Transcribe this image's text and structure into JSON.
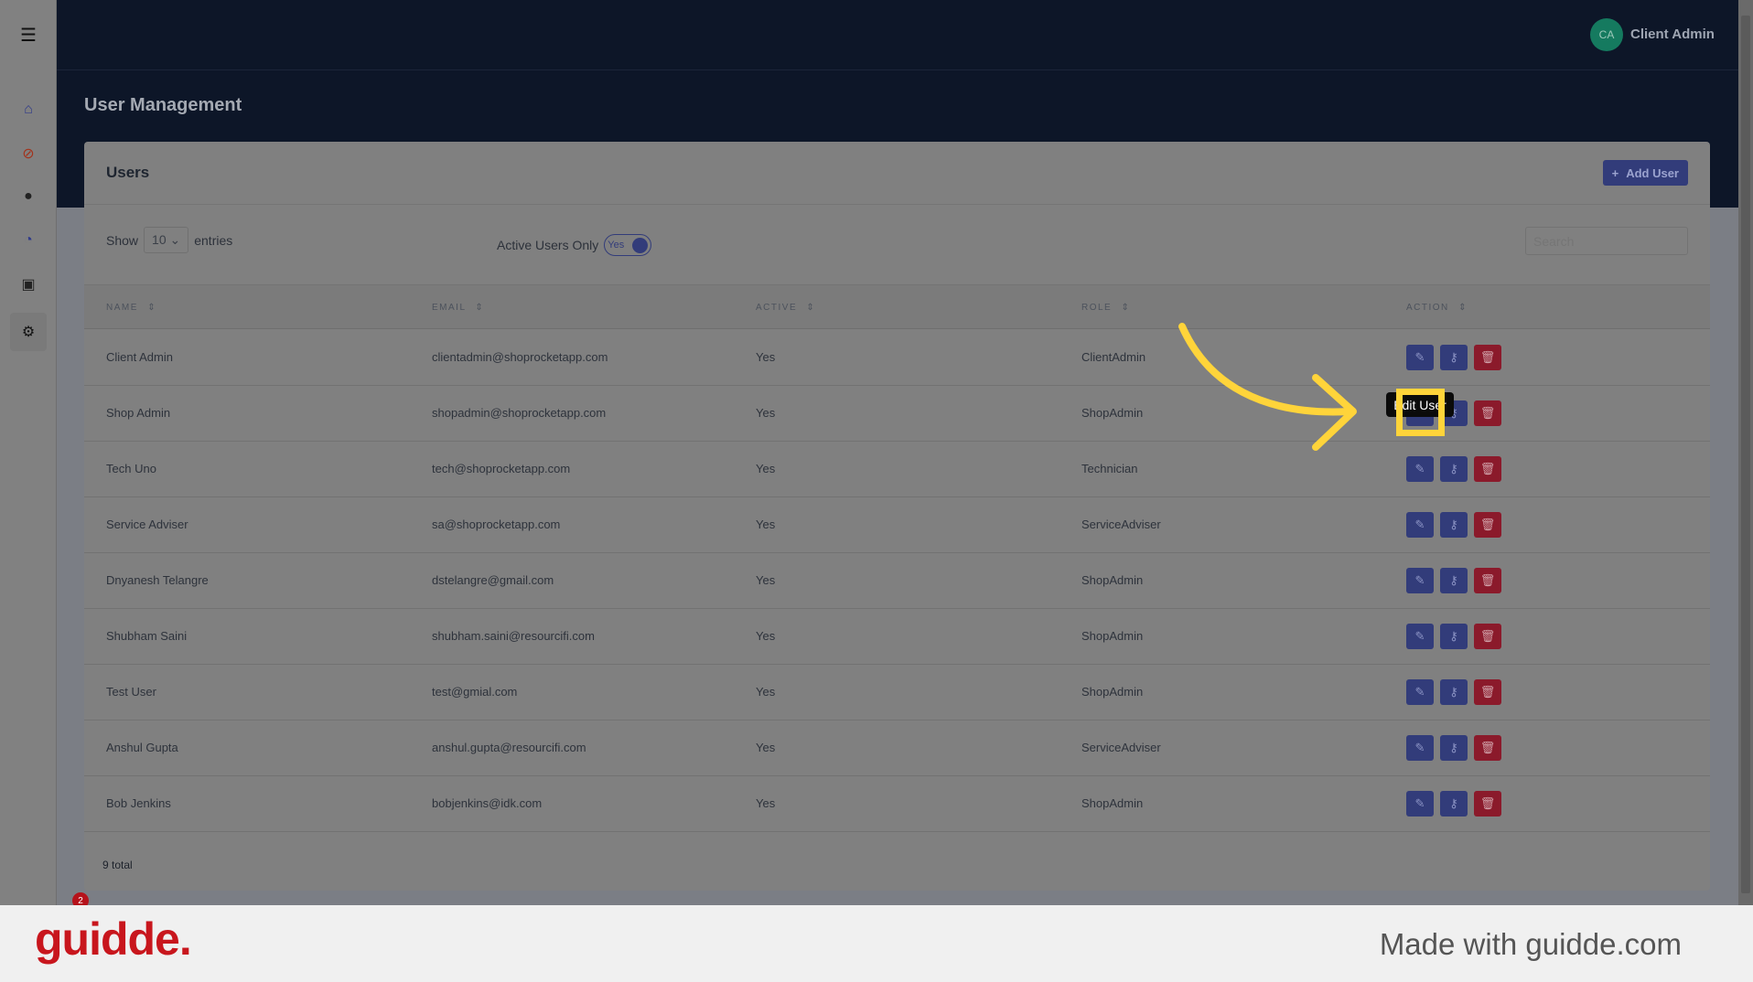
{
  "header": {
    "user_initials": "CA",
    "user_name": "Client Admin",
    "page_title": "User Management"
  },
  "sidebar": {
    "items": [
      {
        "icon": "menu-icon"
      },
      {
        "icon": "store-icon"
      },
      {
        "icon": "compass-icon"
      },
      {
        "icon": "user-icon"
      },
      {
        "icon": "pie-chart-icon"
      },
      {
        "icon": "archive-icon"
      },
      {
        "icon": "gear-icon",
        "active": true
      }
    ]
  },
  "card": {
    "title": "Users",
    "add_label": "Add User",
    "show_label": "Show",
    "entries_value": "10",
    "entries_label": "entries",
    "active_only_label": "Active Users Only",
    "toggle_label": "Yes",
    "search_placeholder": "Search",
    "total": "9 total"
  },
  "table": {
    "columns": [
      "NAME",
      "EMAIL",
      "ACTIVE",
      "ROLE",
      "ACTION"
    ],
    "rows": [
      {
        "name": "Client Admin",
        "email": "clientadmin@shoprocketapp.com",
        "active": "Yes",
        "role": "ClientAdmin"
      },
      {
        "name": "Shop Admin",
        "email": "shopadmin@shoprocketapp.com",
        "active": "Yes",
        "role": "ShopAdmin"
      },
      {
        "name": "Tech Uno",
        "email": "tech@shoprocketapp.com",
        "active": "Yes",
        "role": "Technician"
      },
      {
        "name": "Service Adviser",
        "email": "sa@shoprocketapp.com",
        "active": "Yes",
        "role": "ServiceAdviser"
      },
      {
        "name": "Dnyanesh Telangre",
        "email": "dstelangre@gmail.com",
        "active": "Yes",
        "role": "ShopAdmin"
      },
      {
        "name": "Shubham Saini",
        "email": "shubham.saini@resourcifi.com",
        "active": "Yes",
        "role": "ShopAdmin"
      },
      {
        "name": "Test User",
        "email": "test@gmial.com",
        "active": "Yes",
        "role": "ShopAdmin"
      },
      {
        "name": "Anshul Gupta",
        "email": "anshul.gupta@resourcifi.com",
        "active": "Yes",
        "role": "ServiceAdviser"
      },
      {
        "name": "Bob Jenkins",
        "email": "bobjenkins@idk.com",
        "active": "Yes",
        "role": "ShopAdmin"
      }
    ]
  },
  "tooltip": "Edit User",
  "notification_count": "2",
  "footer": {
    "logo": "guidde.",
    "made_with": "Made with guidde.com"
  },
  "colors": {
    "accent": "#323c7a",
    "danger": "#8b1a2b",
    "highlight": "#ffd43a"
  }
}
